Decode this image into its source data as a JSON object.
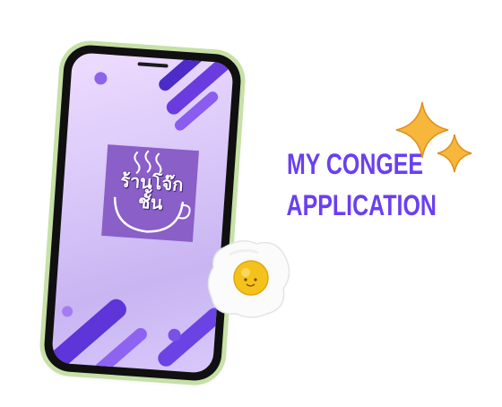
{
  "headline": {
    "line1": "MY CONGEE",
    "line2": "APPLICATION"
  },
  "app_logo": {
    "text": "ร้านโจ๊กชั้น"
  },
  "icons": [
    "steam-icon",
    "bowl-icon",
    "fried-egg-icon",
    "sparkle-icon"
  ],
  "colors": {
    "accent": "#6b3ff0",
    "phone_frame": "#c6e0a6",
    "logo_tile": "#8a5fc8",
    "sparkle": "#f6b23a"
  }
}
